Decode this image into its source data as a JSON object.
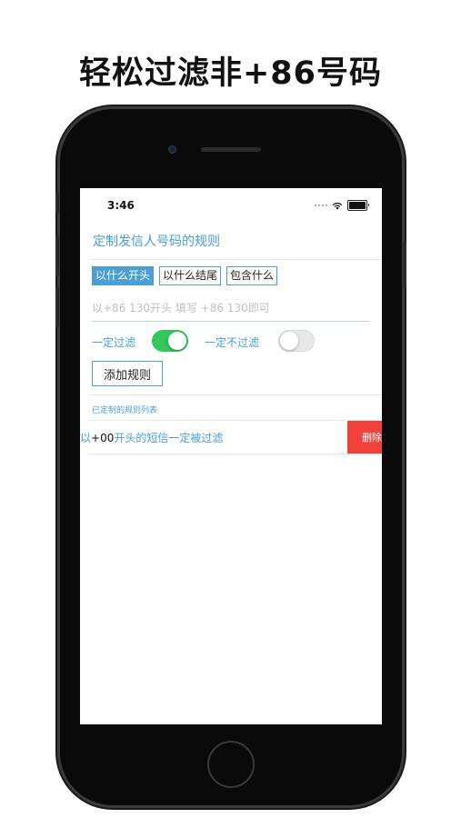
{
  "headline": "轻松过滤非+86号码",
  "status_bar": {
    "time": "3:46"
  },
  "page_title": "定制发信人号码的规则",
  "rule_types": [
    {
      "label": "以什么开头",
      "selected": true
    },
    {
      "label": "以什么结尾",
      "selected": false
    },
    {
      "label": "包含什么",
      "selected": false
    }
  ],
  "number_input": {
    "value": "",
    "placeholder": "以+86 130开头 填写 +86 130即可"
  },
  "filter_toggle": {
    "label": "一定过滤",
    "on": true
  },
  "no_filter_toggle": {
    "label": "一定不过滤",
    "on": false
  },
  "add_button": "添加规则",
  "list_header": "已定制的规则列表",
  "rules": [
    {
      "prefix": "码以",
      "number": "+00",
      "suffix": "开头的短信一定被过滤",
      "delete_label": "删除"
    }
  ],
  "colors": {
    "accent": "#4a9fd6",
    "toggle_on": "#34c759",
    "delete": "#f0413a"
  }
}
